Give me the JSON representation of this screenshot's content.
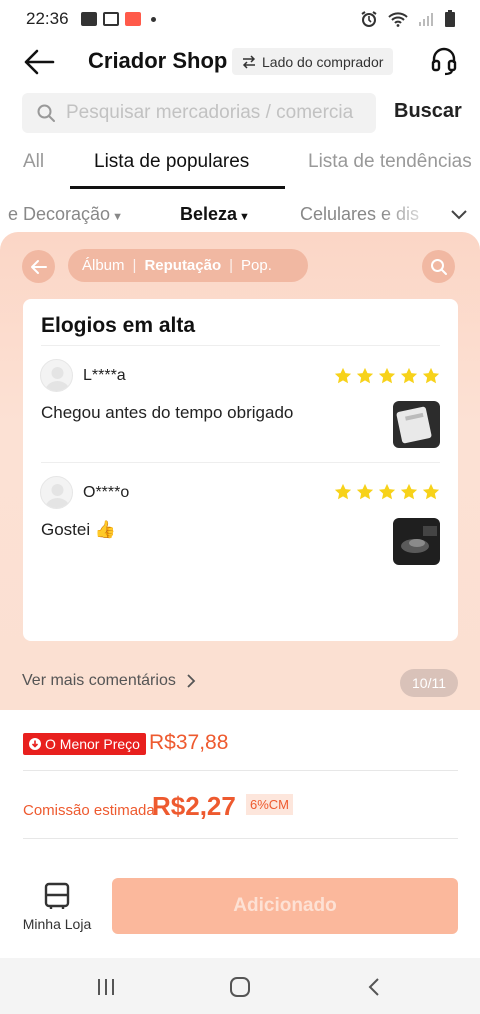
{
  "status_bar": {
    "time": "22:36"
  },
  "header": {
    "title": "Criador Shop",
    "buyer_side": "Lado do comprador"
  },
  "search": {
    "placeholder": "Pesquisar mercadorias / comercia",
    "button_label": "Buscar"
  },
  "tabs": [
    {
      "label": "All"
    },
    {
      "label": "Lista de populares"
    },
    {
      "label": "Lista de tendências"
    }
  ],
  "categories": [
    {
      "label": "e Decoração"
    },
    {
      "label": "Beleza"
    },
    {
      "label": "Celulares e dis"
    }
  ],
  "review_panel": {
    "segments": [
      "Álbum",
      "Reputação",
      "Pop."
    ],
    "card_title": "Elogios em alta",
    "reviews": [
      {
        "user": "L****a",
        "rating": 5,
        "text": "Chegou antes do tempo obrigado"
      },
      {
        "user": "O****o",
        "rating": 5,
        "text": "Gostei 👍"
      }
    ],
    "more_label": "Ver mais comentários",
    "pager": "10/11"
  },
  "price": {
    "badge": "O Menor Preço",
    "value": "R$37,88"
  },
  "commission": {
    "label": "Comissão estimada",
    "value": "R$2,27",
    "percent": "6%CM"
  },
  "bottom_bar": {
    "store_label": "Minha Loja",
    "add_button": "Adicionado"
  },
  "colors": {
    "accent": "#ee5a2f",
    "badge_red": "#e8201e",
    "panel_bg": "#fbd6c6",
    "star": "#f7d21a",
    "add_button": "#fbb89c"
  }
}
